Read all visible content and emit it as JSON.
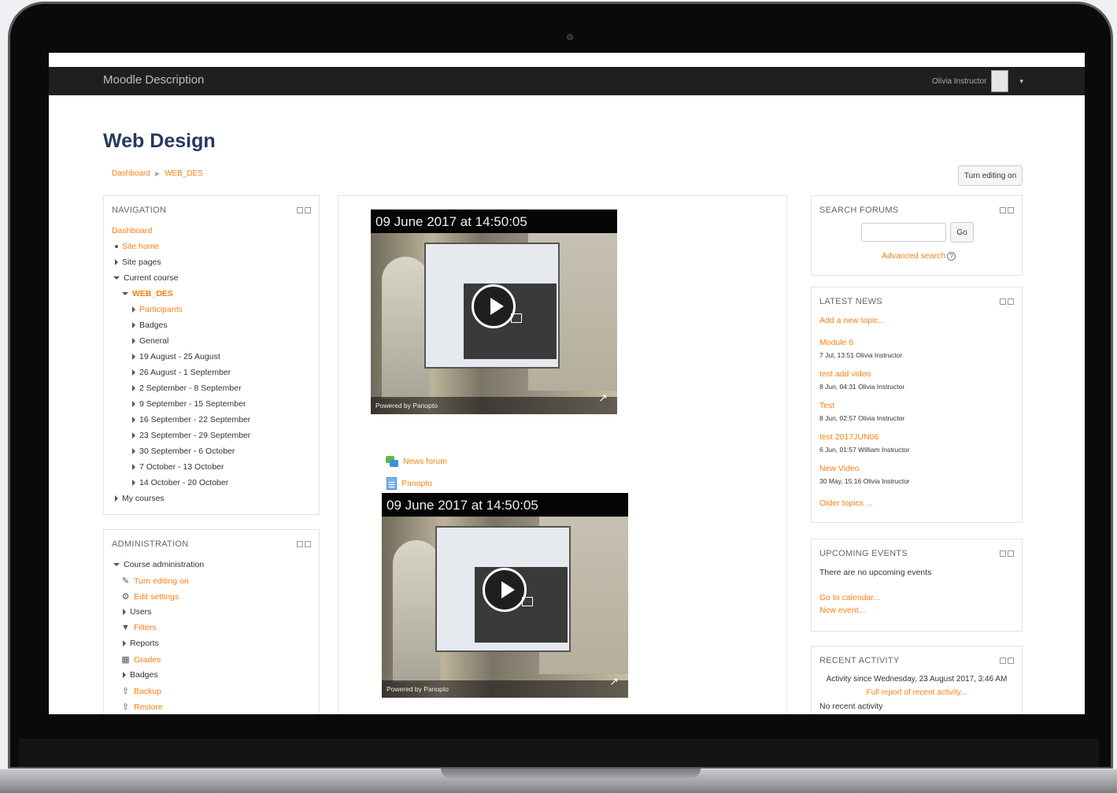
{
  "navbar": {
    "brand": "Moodle Description",
    "user_name": "Olivia Instructor"
  },
  "page": {
    "title": "Web Design"
  },
  "breadcrumb": {
    "items": [
      "Dashboard",
      "WEB_DES"
    ]
  },
  "buttons": {
    "turn_editing_on": "Turn editing on"
  },
  "navigation": {
    "title": "NAVIGATION",
    "dashboard": "Dashboard",
    "site_home": "Site home",
    "site_pages": "Site pages",
    "current_course": "Current course",
    "course_code": "WEB_DES",
    "participants": "Participants",
    "badges": "Badges",
    "general": "General",
    "weeks": [
      "19 August - 25 August",
      "26 August - 1 September",
      "2 September - 8 September",
      "9 September - 15 September",
      "16 September - 22 September",
      "23 September - 29 September",
      "30 September - 6 October",
      "7 October - 13 October",
      "14 October - 20 October"
    ],
    "my_courses": "My courses"
  },
  "administration": {
    "title": "ADMINISTRATION",
    "course_admin": "Course administration",
    "items": [
      "Turn editing on",
      "Edit settings",
      "Users",
      "Filters",
      "Reports",
      "Grades",
      "Badges",
      "Backup",
      "Restore"
    ]
  },
  "main": {
    "video1": {
      "timestamp": "09 June 2017 at 14:50:05",
      "powered_by": "Powered by Panopto"
    },
    "video2": {
      "timestamp": "09 June 2017 at 14:50:05",
      "powered_by": "Powered by Panopto"
    },
    "activities": [
      "News forum",
      "Panopto"
    ]
  },
  "search_forums": {
    "title": "SEARCH FORUMS",
    "go": "Go",
    "advanced": "Advanced search",
    "help": "?"
  },
  "latest_news": {
    "title": "LATEST NEWS",
    "add_topic": "Add a new topic...",
    "items": [
      {
        "title": "Module 6",
        "meta": "7 Jul, 13:51 Olivia Instructor"
      },
      {
        "title": "test add video",
        "meta": "8 Jun, 04:31 Olivia Instructor"
      },
      {
        "title": "Test",
        "meta": "8 Jun, 02:57 Olivia Instructor"
      },
      {
        "title": "test 2017JUN06",
        "meta": "6 Jun, 01:57 William Instructor"
      },
      {
        "title": "New Video",
        "meta": "30 May, 15:16 Olivia Instructor"
      }
    ],
    "older": "Older topics ..."
  },
  "upcoming_events": {
    "title": "UPCOMING EVENTS",
    "empty": "There are no upcoming events",
    "calendar": "Go to calendar...",
    "new_event": "New event..."
  },
  "recent_activity": {
    "title": "RECENT ACTIVITY",
    "since": "Activity since Wednesday, 23 August 2017, 3:46 AM",
    "full_report": "Full report of recent activity...",
    "none": "No recent activity"
  }
}
